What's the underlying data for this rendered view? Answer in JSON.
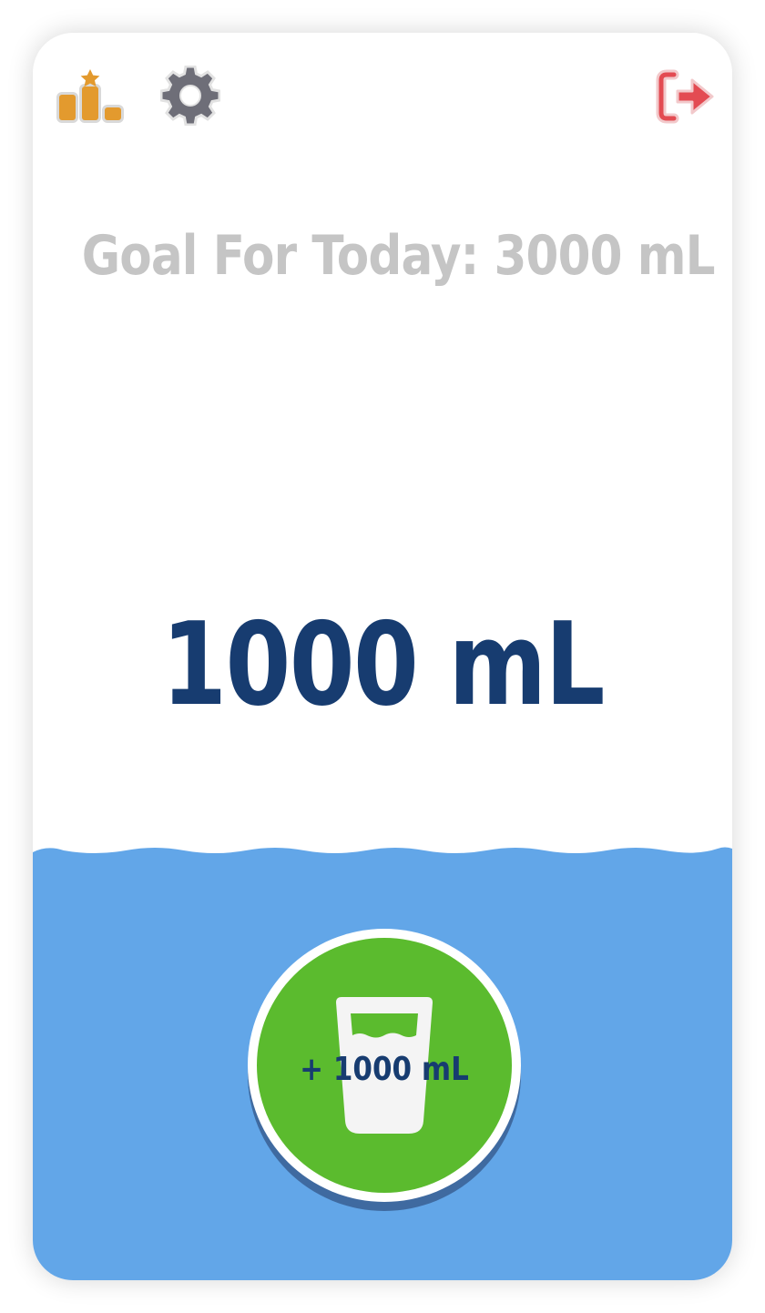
{
  "header": {
    "leaderboard_icon": "leaderboard-podium-icon",
    "settings_icon": "gear-icon",
    "logout_icon": "logout-icon"
  },
  "goal": {
    "text": "Goal For Today: 3000 mL"
  },
  "intake": {
    "current": "1000 mL",
    "goal_ml": 3000,
    "current_ml": 1000
  },
  "add_button": {
    "label": "+ 1000 mL",
    "icon": "water-glass-icon"
  },
  "colors": {
    "water": "#62a6e8",
    "button_green": "#5bbb2e",
    "amount_text": "#173c70",
    "goal_text": "#c5c5c5",
    "leaderboard": "#e39a2e",
    "settings": "#6e6e78",
    "logout": "#e34b52"
  }
}
